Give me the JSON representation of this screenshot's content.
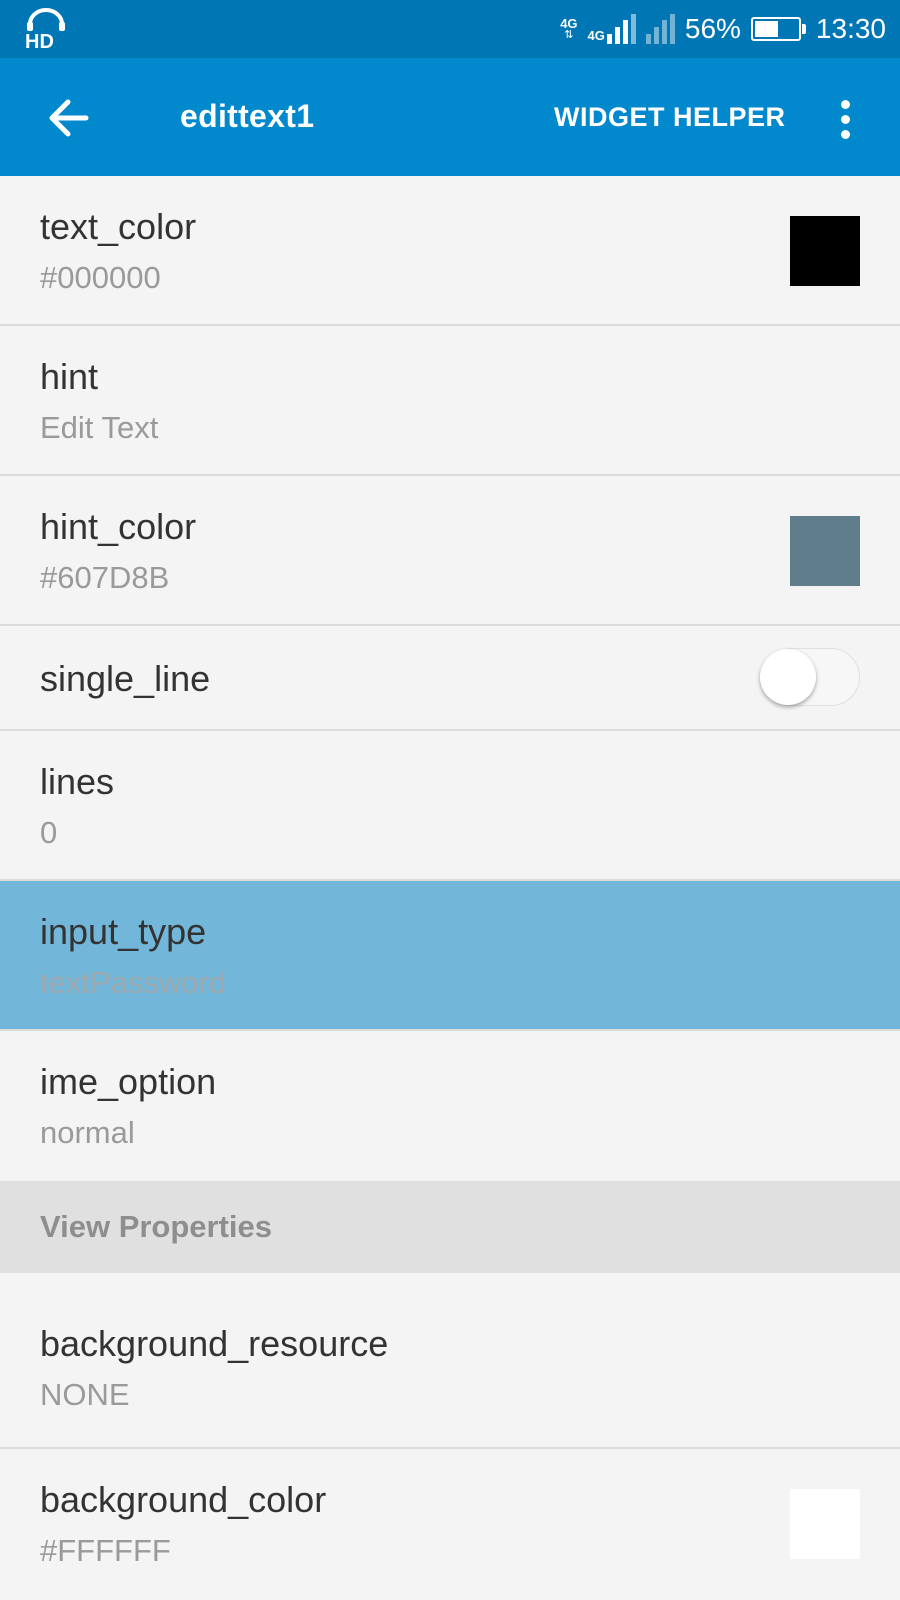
{
  "status_bar": {
    "hd_label": "HD",
    "net1": "4G",
    "net2": "4G",
    "battery_percent": "56%",
    "battery_level": 0.56,
    "time": "13:30"
  },
  "app_bar": {
    "title": "edittext1",
    "action_label": "WIDGET HELPER",
    "back_icon": "arrow-left-icon",
    "overflow_icon": "more-vert-icon",
    "background": "#0288cc"
  },
  "properties": [
    {
      "label": "text_color",
      "value": "#000000",
      "swatch": "#000000"
    },
    {
      "label": "hint",
      "value": "Edit Text"
    },
    {
      "label": "hint_color",
      "value": "#607D8B",
      "swatch": "#607D8B"
    },
    {
      "label": "single_line",
      "toggle": false
    },
    {
      "label": "lines",
      "value": "0"
    },
    {
      "label": "input_type",
      "value": "textPassword",
      "selected": true
    },
    {
      "label": "ime_option",
      "value": "normal"
    }
  ],
  "section": {
    "title": "View Properties"
  },
  "view_properties": [
    {
      "label": "background_resource",
      "value": "NONE"
    },
    {
      "label": "background_color",
      "value": "#FFFFFF",
      "swatch": "#FFFFFF"
    }
  ],
  "colors": {
    "status_bar": "#0076b5",
    "selected_row": "#72b7d9",
    "section_header": "#e0e0e0"
  }
}
